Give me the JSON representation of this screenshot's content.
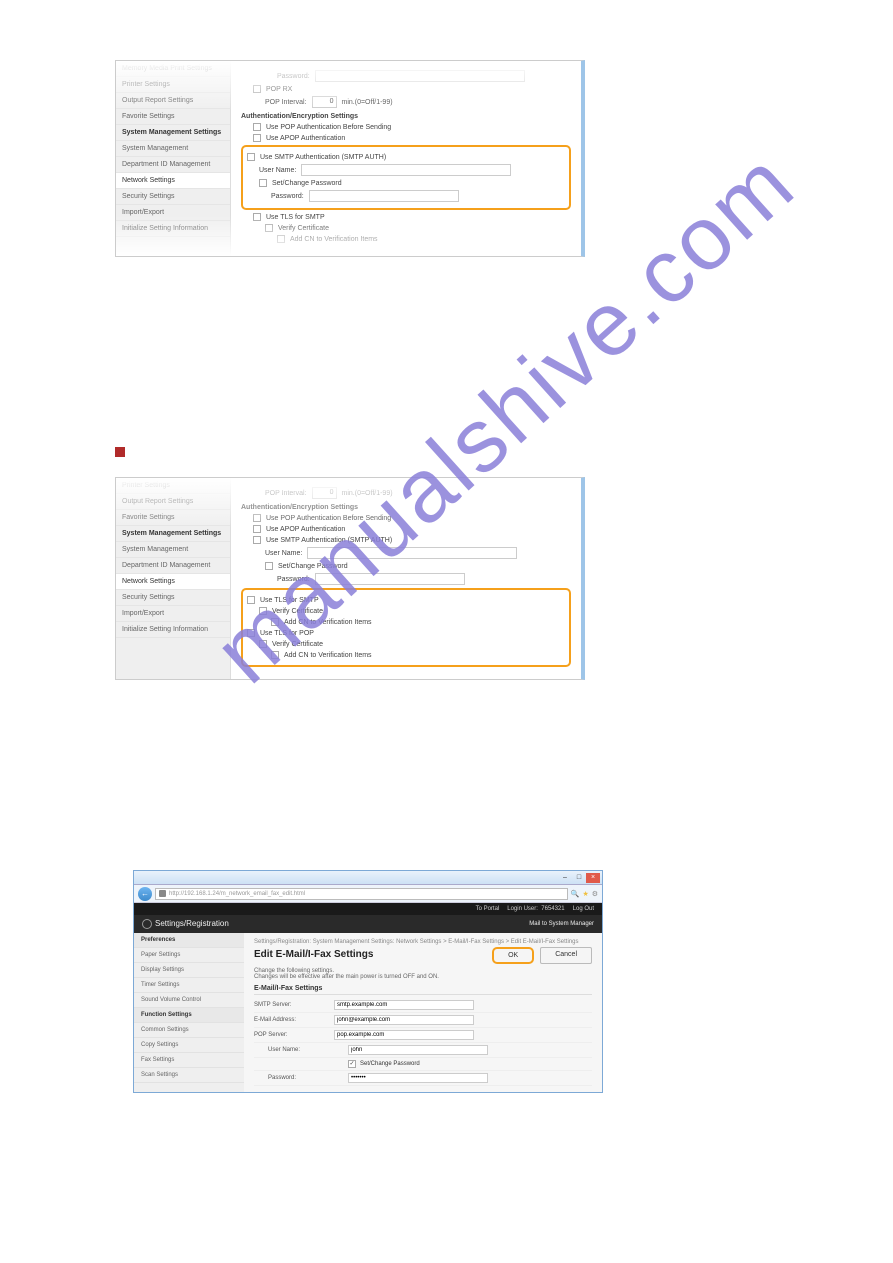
{
  "watermark": "manualshive.com",
  "sidebar_items_a": [
    {
      "label": "Memory Media Print Settings",
      "active": false
    },
    {
      "label": "Printer Settings",
      "active": false
    },
    {
      "label": "Output Report Settings",
      "active": false
    },
    {
      "label": "Favorite Settings",
      "active": false
    },
    {
      "label": "System Management Settings",
      "header": true
    },
    {
      "label": "System Management",
      "active": false
    },
    {
      "label": "Department ID Management",
      "active": false
    },
    {
      "label": "Network Settings",
      "active": true
    },
    {
      "label": "Security Settings",
      "active": false
    },
    {
      "label": "Import/Export",
      "active": false
    },
    {
      "label": "Initialize Setting Information",
      "active": false
    }
  ],
  "panel_a": {
    "password_label": "Password:",
    "pop_rx": "POP RX",
    "pop_interval": "POP Interval:",
    "pop_interval_hint": "min.(0=Off/1-99)",
    "pop_interval_value": "0",
    "section": "Authentication/Encryption Settings",
    "use_pop_auth": "Use POP Authentication Before Sending",
    "use_apop": "Use APOP Authentication",
    "use_smtp_auth": "Use SMTP Authentication (SMTP AUTH)",
    "username": "User Name:",
    "set_change_pw": "Set/Change Password",
    "password2": "Password:",
    "use_tls_smtp": "Use TLS for SMTP",
    "verify_cert": "Verify Certificate",
    "add_cn": "Add CN to Verification Items"
  },
  "sidebar_items_b": [
    {
      "label": "Printer Settings",
      "active": false
    },
    {
      "label": "Output Report Settings",
      "active": false
    },
    {
      "label": "Favorite Settings",
      "active": false
    },
    {
      "label": "System Management Settings",
      "header": true
    },
    {
      "label": "System Management",
      "active": false
    },
    {
      "label": "Department ID Management",
      "active": false
    },
    {
      "label": "Network Settings",
      "active": true
    },
    {
      "label": "Security Settings",
      "active": false
    },
    {
      "label": "Import/Export",
      "active": false
    },
    {
      "label": "Initialize Setting Information",
      "active": false
    }
  ],
  "panel_b": {
    "pop_interval": "POP Interval:",
    "pop_interval_hint": "min.(0=Off/1-99)",
    "pop_interval_value": "0",
    "section": "Authentication/Encryption Settings",
    "use_pop_auth": "Use POP Authentication Before Sending",
    "use_apop": "Use APOP Authentication",
    "use_smtp_auth": "Use SMTP Authentication (SMTP AUTH)",
    "username": "User Name:",
    "set_change_pw": "Set/Change Password",
    "password": "Password:",
    "use_tls_smtp": "Use TLS for SMTP",
    "verify_cert": "Verify Certificate",
    "add_cn": "Add CN to Verification Items",
    "use_tls_pop": "Use TLS for POP",
    "verify_cert2": "Verify Certificate",
    "add_cn2": "Add CN to Verification Items"
  },
  "browser": {
    "url": "http://192.168.1.24/m_network_email_fax_edit.html",
    "topbar": {
      "to_portal": "To Portal",
      "login_user": "Login User:",
      "user_id": "7654321",
      "logout": "Log Out"
    },
    "regbar": {
      "title": "Settings/Registration",
      "mail": "Mail to System Manager"
    },
    "sidebar": {
      "prefs": "Preferences",
      "items": [
        "Paper Settings",
        "Display Settings",
        "Timer Settings",
        "Sound Volume Control"
      ],
      "func": "Function Settings",
      "items2": [
        "Common Settings",
        "Copy Settings",
        "Fax Settings",
        "Scan Settings"
      ]
    },
    "content": {
      "breadcrumb": "Settings/Registration: System Management Settings: Network Settings > E-Mail/I-Fax Settings > Edit E-Mail/I-Fax Settings",
      "title": "Edit E-Mail/I-Fax Settings",
      "subtext1": "Change the following settings.",
      "subtext2": "Changes will be effective after the main power is turned OFF and ON.",
      "ok": "OK",
      "cancel": "Cancel",
      "section": "E-Mail/I-Fax Settings",
      "fields": {
        "smtp_server_lbl": "SMTP Server:",
        "smtp_server_val": "smtp.example.com",
        "email_lbl": "E-Mail Address:",
        "email_val": "john@example.com",
        "pop_server_lbl": "POP Server:",
        "pop_server_val": "pop.example.com",
        "username_lbl": "User Name:",
        "username_val": "john",
        "setpw": "Set/Change Password",
        "password_lbl": "Password:"
      }
    }
  }
}
